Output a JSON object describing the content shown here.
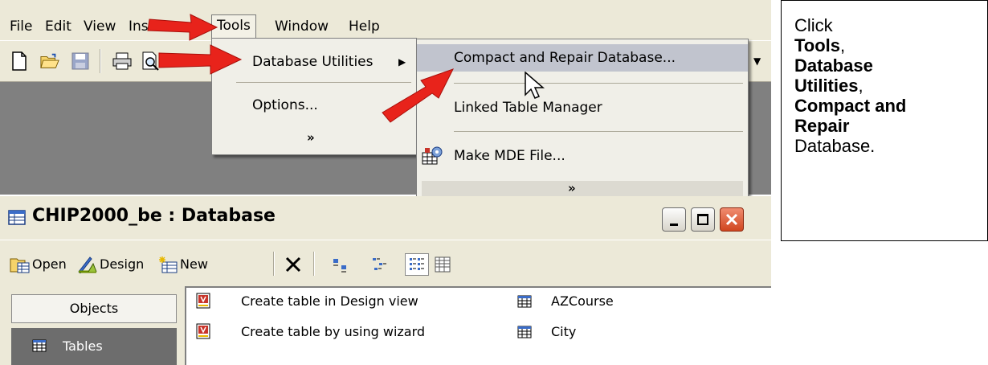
{
  "menubar": {
    "items": [
      "File",
      "Edit",
      "View",
      "Inse",
      "Tools",
      "Window",
      "Help"
    ],
    "mnemonics": [
      "F",
      "E",
      "V",
      "I",
      "T",
      "W",
      "H"
    ]
  },
  "tools_menu": {
    "items": [
      "Database Utilities",
      "Options...",
      "»"
    ]
  },
  "sub_menu": {
    "items": [
      "Compact and Repair Database...",
      "Linked Table Manager",
      "Make MDE File...",
      "»"
    ]
  },
  "db_window": {
    "title": "CHIP2000_be : Database",
    "toolbar": [
      "Open",
      "Design",
      "New"
    ],
    "objects_button": "Objects",
    "tables_item": "Tables",
    "list_left": [
      "Create table in Design view",
      "Create table by using wizard"
    ],
    "list_right": [
      "AZCourse",
      "City"
    ]
  },
  "callout": {
    "lead": "Click",
    "bold1": "Tools",
    "comma1": ",",
    "bold2a": "Database",
    "bold2b": "Utilities",
    "comma2": ",",
    "bold3a": "Compact and",
    "bold3b": "Repair",
    "tail": "Database."
  },
  "colors": {
    "chrome": "#ece9d8",
    "workspace": "#808080",
    "highlight": "#c1c4ce",
    "arrow": "#e8231b",
    "close_button": "#d0461f"
  },
  "icons": [
    "new-file-icon",
    "open-folder-icon",
    "save-icon",
    "print-icon",
    "print-preview-icon",
    "submenu-arrow-icon",
    "mouse-cursor-icon",
    "make-mde-icon",
    "database-icon",
    "minimize-icon",
    "maximize-icon",
    "close-icon",
    "open-object-icon",
    "design-icon",
    "new-object-icon",
    "delete-icon",
    "large-icons-icon",
    "small-icons-icon",
    "list-view-icon",
    "details-view-icon",
    "table-icon",
    "wizard-icon"
  ]
}
